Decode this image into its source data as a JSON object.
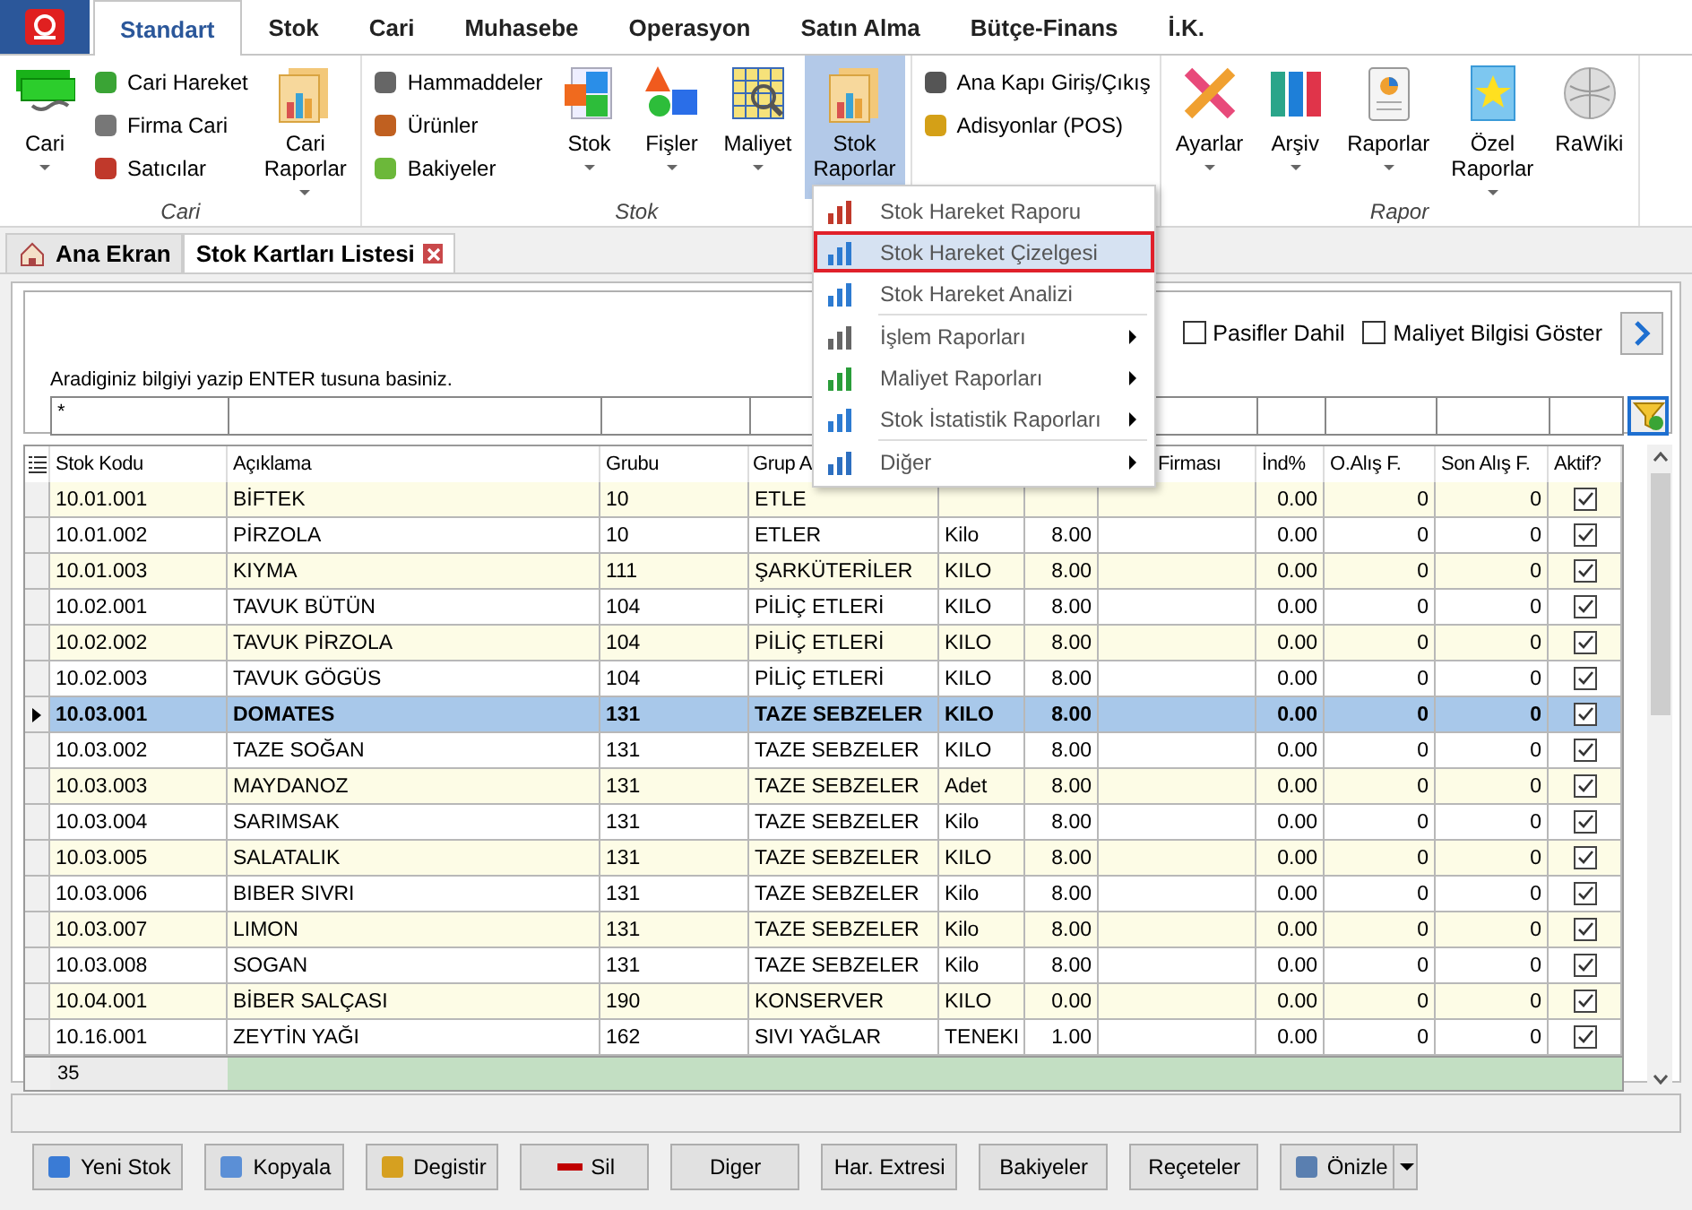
{
  "ribbon": {
    "tabs": [
      {
        "label": "Standart",
        "selected": true
      },
      {
        "label": "Stok",
        "selected": false
      },
      {
        "label": "Cari",
        "selected": false
      },
      {
        "label": "Muhasebe",
        "selected": false
      },
      {
        "label": "Operasyon",
        "selected": false
      },
      {
        "label": "Satın Alma",
        "selected": false
      },
      {
        "label": "Bütçe-Finans",
        "selected": false
      },
      {
        "label": "İ.K.",
        "selected": false
      }
    ],
    "groups": [
      {
        "label": "Cari",
        "items": [
          {
            "kind": "large",
            "label": "Cari",
            "dropdown": true,
            "pressed": false
          },
          {
            "kind": "stack",
            "entries": [
              "Cari Hareket",
              "Firma Cari",
              "Satıcılar"
            ]
          },
          {
            "kind": "large",
            "label": "Cari Raporlar",
            "dropdown": true,
            "pressed": false
          }
        ]
      },
      {
        "label": "Stok",
        "items": [
          {
            "kind": "stack",
            "entries": [
              "Hammaddeler",
              "Ürünler",
              "Bakiyeler"
            ]
          },
          {
            "kind": "large",
            "label": "Stok",
            "dropdown": true,
            "pressed": false
          },
          {
            "kind": "large",
            "label": "Fişler",
            "dropdown": true,
            "pressed": false
          },
          {
            "kind": "large",
            "label": "Maliyet",
            "dropdown": true,
            "pressed": false
          },
          {
            "kind": "large",
            "label": "Stok Raporlar",
            "dropdown": true,
            "pressed": true
          }
        ]
      },
      {
        "items": [
          {
            "kind": "stack",
            "entries": [
              "Ana Kapı Giriş/Çıkış",
              "Adisyonlar (POS)"
            ]
          }
        ]
      },
      {
        "label": "Rapor",
        "items": [
          {
            "kind": "large",
            "label": "Ayarlar",
            "dropdown": true,
            "pressed": false
          },
          {
            "kind": "large",
            "label": "Arşiv",
            "dropdown": true,
            "pressed": false
          },
          {
            "kind": "large",
            "label": "Raporlar",
            "dropdown": true,
            "pressed": false
          },
          {
            "kind": "large",
            "label": "Özel Raporlar",
            "dropdown": true,
            "pressed": false
          },
          {
            "kind": "large",
            "label": "RaWiki",
            "dropdown": false,
            "pressed": false
          }
        ]
      }
    ]
  },
  "menu": [
    {
      "label": "Stok Hareket Raporu",
      "selected": false,
      "submenu": false,
      "separator_before": false
    },
    {
      "label": "Stok Hareket Çizelgesi",
      "selected": true,
      "submenu": false,
      "separator_before": false
    },
    {
      "label": "Stok Hareket Analizi",
      "selected": false,
      "submenu": false,
      "separator_before": false
    },
    {
      "label": "İşlem Raporları",
      "selected": false,
      "submenu": true,
      "separator_before": true
    },
    {
      "label": "Maliyet Raporları",
      "selected": false,
      "submenu": true,
      "separator_before": false
    },
    {
      "label": "Stok İstatistik Raporları",
      "selected": false,
      "submenu": true,
      "separator_before": false
    },
    {
      "label": "Diğer",
      "selected": false,
      "submenu": true,
      "separator_before": true
    }
  ],
  "doc_tabs": [
    {
      "label": "Ana Ekran",
      "selected": false,
      "closable": false
    },
    {
      "label": "Stok Kartları Listesi",
      "selected": true,
      "closable": true
    }
  ],
  "search": {
    "options": [
      {
        "label": "Pasifler Dahil",
        "checked": false
      },
      {
        "label": "Maliyet Bilgisi Göster",
        "checked": false
      }
    ],
    "hint": "Aradiginiz bilgiyi yazip ENTER tusuna basiniz.",
    "filter_value": "*"
  },
  "table": {
    "columns": [
      "Stok Kodu",
      "Açıklama",
      "Grubu",
      "Grup A",
      null,
      null,
      "Firması",
      "İnd%",
      "O.Alış F.",
      "Son Alış F.",
      "Aktif?"
    ],
    "rows": [
      {
        "cells": [
          "10.01.001",
          "BİFTEK",
          "10",
          "ETLE",
          null,
          null,
          null,
          "0.00",
          "0",
          "0"
        ],
        "active": true,
        "selected": false
      },
      {
        "cells": [
          "10.01.002",
          "PİRZOLA",
          "10",
          "ETLER",
          "Kilo",
          "8.00",
          "",
          "0.00",
          "0",
          "0"
        ],
        "active": true,
        "selected": false
      },
      {
        "cells": [
          "10.01.003",
          "KIYMA",
          "111",
          "ŞARKÜTERİLER",
          "KILO",
          "8.00",
          "",
          "0.00",
          "0",
          "0"
        ],
        "active": true,
        "selected": false
      },
      {
        "cells": [
          "10.02.001",
          "TAVUK BÜTÜN",
          "104",
          "PİLİÇ ETLERİ",
          "KILO",
          "8.00",
          "",
          "0.00",
          "0",
          "0"
        ],
        "active": true,
        "selected": false
      },
      {
        "cells": [
          "10.02.002",
          "TAVUK PİRZOLA",
          "104",
          "PİLİÇ ETLERİ",
          "KILO",
          "8.00",
          "",
          "0.00",
          "0",
          "0"
        ],
        "active": true,
        "selected": false
      },
      {
        "cells": [
          "10.02.003",
          "TAVUK GÖGÜS",
          "104",
          "PİLİÇ ETLERİ",
          "KILO",
          "8.00",
          "",
          "0.00",
          "0",
          "0"
        ],
        "active": true,
        "selected": false
      },
      {
        "cells": [
          "10.03.001",
          "DOMATES",
          "131",
          "TAZE SEBZELER",
          "KILO",
          "8.00",
          "",
          "0.00",
          "0",
          "0"
        ],
        "active": true,
        "selected": true
      },
      {
        "cells": [
          "10.03.002",
          "TAZE SOĞAN",
          "131",
          "TAZE SEBZELER",
          "KILO",
          "8.00",
          "",
          "0.00",
          "0",
          "0"
        ],
        "active": true,
        "selected": false
      },
      {
        "cells": [
          "10.03.003",
          "MAYDANOZ",
          "131",
          "TAZE SEBZELER",
          "Adet",
          "8.00",
          "",
          "0.00",
          "0",
          "0"
        ],
        "active": true,
        "selected": false
      },
      {
        "cells": [
          "10.03.004",
          "SARIMSAK",
          "131",
          "TAZE SEBZELER",
          "Kilo",
          "8.00",
          "",
          "0.00",
          "0",
          "0"
        ],
        "active": true,
        "selected": false
      },
      {
        "cells": [
          "10.03.005",
          "SALATALIK",
          "131",
          "TAZE SEBZELER",
          "KILO",
          "8.00",
          "",
          "0.00",
          "0",
          "0"
        ],
        "active": true,
        "selected": false
      },
      {
        "cells": [
          "10.03.006",
          "BIBER SIVRI",
          "131",
          "TAZE SEBZELER",
          "Kilo",
          "8.00",
          "",
          "0.00",
          "0",
          "0"
        ],
        "active": true,
        "selected": false
      },
      {
        "cells": [
          "10.03.007",
          "LIMON",
          "131",
          "TAZE SEBZELER",
          "Kilo",
          "8.00",
          "",
          "0.00",
          "0",
          "0"
        ],
        "active": true,
        "selected": false
      },
      {
        "cells": [
          "10.03.008",
          "SOGAN",
          "131",
          "TAZE SEBZELER",
          "Kilo",
          "8.00",
          "",
          "0.00",
          "0",
          "0"
        ],
        "active": true,
        "selected": false
      },
      {
        "cells": [
          "10.04.001",
          "BİBER SALÇASI",
          "190",
          "KONSERVER",
          "KILO",
          "0.00",
          "",
          "0.00",
          "0",
          "0"
        ],
        "active": true,
        "selected": false
      },
      {
        "cells": [
          "10.16.001",
          "ZEYTİN YAĞI",
          "162",
          "SIVI YAĞLAR",
          "TENEKI",
          "1.00",
          "",
          "0.00",
          "0",
          "0"
        ],
        "active": true,
        "selected": false
      }
    ],
    "footer_count": "35"
  },
  "buttons": [
    {
      "label": "Yeni Stok",
      "dropdown": false
    },
    {
      "label": "Kopyala",
      "dropdown": false
    },
    {
      "label": "Degistir",
      "dropdown": false
    },
    {
      "label": "Sil",
      "dropdown": false
    },
    {
      "label": "Diger",
      "dropdown": false
    },
    {
      "label": "Har. Extresi",
      "dropdown": false
    },
    {
      "label": "Bakiyeler",
      "dropdown": false
    },
    {
      "label": "Reçeteler",
      "dropdown": false
    },
    {
      "label": "Önizle",
      "dropdown": true
    }
  ]
}
